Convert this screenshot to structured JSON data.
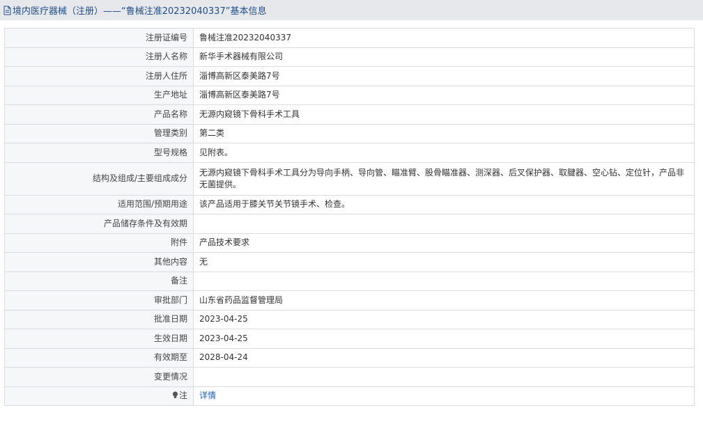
{
  "header": {
    "title": "境内医疗器械（注册）——“鲁械注准20232040337”基本信息",
    "icon": "document-icon"
  },
  "rows": [
    {
      "label": "注册证编号",
      "value": "鲁械注准20232040337"
    },
    {
      "label": "注册人名称",
      "value": "新华手术器械有限公司"
    },
    {
      "label": "注册人住所",
      "value": "淄博高新区泰美路7号"
    },
    {
      "label": "生产地址",
      "value": "淄博高新区泰美路7号"
    },
    {
      "label": "产品名称",
      "value": "无源内窥镜下骨科手术工具"
    },
    {
      "label": "管理类别",
      "value": "第二类"
    },
    {
      "label": "型号规格",
      "value": "见附表。"
    },
    {
      "label": "结构及组成/主要组成成分",
      "value": "无源内窥镜下骨科手术工具分为导向手柄、导向管、瞄准臂、股骨瞄准器、测深器、后叉保护器、取腱器、空心钻、定位针，产品非无菌提供。"
    },
    {
      "label": "适用范围/预期用途",
      "value": "该产品适用于膝关节关节镜手术、检查。"
    },
    {
      "label": "产品储存条件及有效期",
      "value": ""
    },
    {
      "label": "附件",
      "value": "产品技术要求"
    },
    {
      "label": "其他内容",
      "value": "无"
    },
    {
      "label": "备注",
      "value": ""
    },
    {
      "label": "审批部门",
      "value": "山东省药品监督管理局"
    },
    {
      "label": "批准日期",
      "value": "2023-04-25"
    },
    {
      "label": "生效日期",
      "value": "2023-04-25"
    },
    {
      "label": "有效期至",
      "value": "2028-04-24"
    },
    {
      "label": "变更情况",
      "value": ""
    }
  ],
  "note": {
    "label": "注",
    "icon": "lightbulb-icon",
    "link_text": "详情"
  },
  "colors": {
    "title_bar_bg": "#e6e8ec",
    "title_text": "#1f4e8c",
    "label_bg": "#f6f7f9",
    "border": "#d9dbe0",
    "link": "#1f5fb4"
  }
}
